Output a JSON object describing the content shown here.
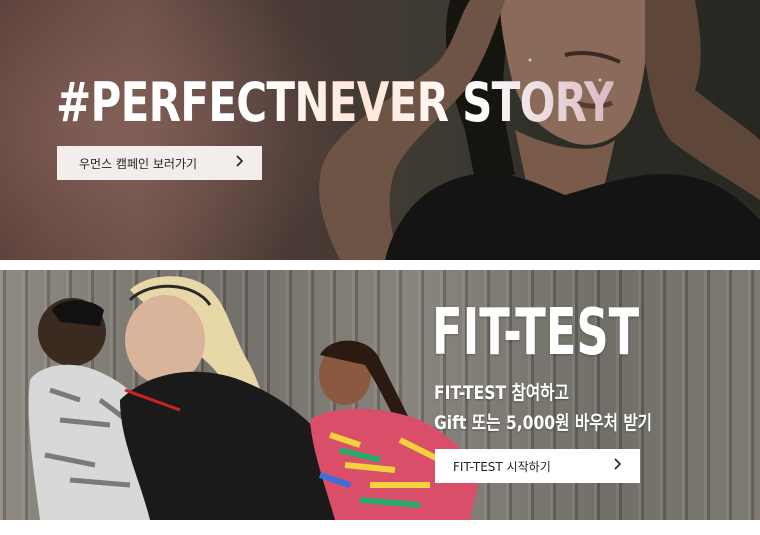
{
  "banner_women": {
    "headline": "#PERFECTNEVER STORY",
    "cta_label": "우먼스 캠페인 보러가기",
    "cta_icon": "chevron-right-icon"
  },
  "banner_fittest": {
    "headline": "FIT-TEST",
    "subline_1": "FIT-TEST  참여하고",
    "subline_2": "Gift 또는 5,000원 바우처 받기",
    "cta_label": "FIT-TEST  시작하기",
    "cta_icon": "chevron-right-icon"
  },
  "colors": {
    "cta_background": "#f3eeeb",
    "text_light": "#ffffff",
    "text_dark": "#222222"
  }
}
